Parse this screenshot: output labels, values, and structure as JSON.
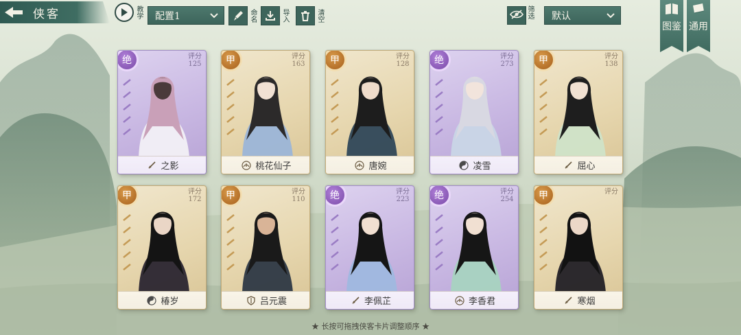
{
  "header": {
    "title": "侠客",
    "teach_label": "教学",
    "config_value": "配置1",
    "rename_label": "命名",
    "import_label": "导入",
    "clear_label": "清空",
    "filter_label": "筛选",
    "sort_value": "默认",
    "codex_label": "图鉴",
    "common_label": "通用"
  },
  "score_label": "评分",
  "cards": [
    {
      "name": "之影",
      "tier": "绝",
      "score": "125",
      "tier_class": "jue",
      "school": "sword"
    },
    {
      "name": "桃花仙子",
      "tier": "甲",
      "score": "163",
      "tier_class": "jia",
      "school": "lotus"
    },
    {
      "name": "唐婉",
      "tier": "甲",
      "score": "128",
      "tier_class": "jia",
      "school": "lotus"
    },
    {
      "name": "凌雪",
      "tier": "绝",
      "score": "273",
      "tier_class": "jue",
      "school": "taiji"
    },
    {
      "name": "屈心",
      "tier": "甲",
      "score": "138",
      "tier_class": "jia",
      "school": "sword"
    },
    {
      "name": "椿岁",
      "tier": "甲",
      "score": "172",
      "tier_class": "jia",
      "school": "taiji"
    },
    {
      "name": "吕元震",
      "tier": "甲",
      "score": "110",
      "tier_class": "jia",
      "school": "shield"
    },
    {
      "name": "李佩芷",
      "tier": "绝",
      "score": "223",
      "tier_class": "jue",
      "school": "sword"
    },
    {
      "name": "李香君",
      "tier": "绝",
      "score": "254",
      "tier_class": "jue",
      "school": "lotus"
    },
    {
      "name": "寒烟",
      "tier": "甲",
      "score": "",
      "tier_class": "jia",
      "school": "sword"
    }
  ],
  "hint": "★ 长按可拖拽侠客卡片调整顺序 ★",
  "colors": {
    "jade": "#3d655b",
    "jia_badge": "#a65f1c",
    "jue_badge": "#7a4aa8"
  }
}
